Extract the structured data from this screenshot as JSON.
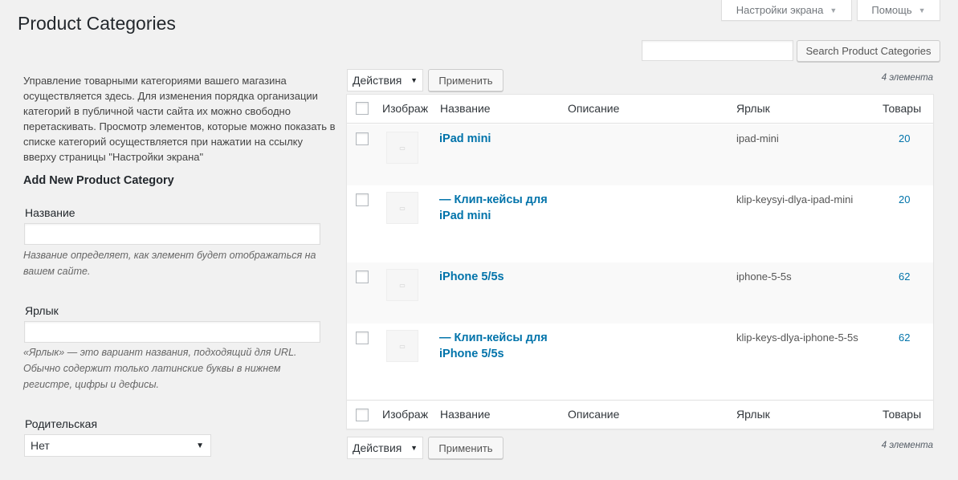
{
  "page_title": "Product Categories",
  "screen_options": {
    "label": "Настройки экрана"
  },
  "help": {
    "label": "Помощь"
  },
  "search": {
    "placeholder": "",
    "button_label": "Search Product Categories"
  },
  "description": "Управление товарными категориями вашего магазина осуществляется здесь. Для изменения порядка организации категорий в публичной части сайта их можно свободно перетаскивать. Просмотр элементов, которые можно показать в списке категорий осуществляется при нажатии на ссылку вверху страницы \"Настройки экрана\"",
  "form": {
    "title": "Add New Product Category",
    "name_label": "Название",
    "name_value": "",
    "name_hint": "Название определяет, как элемент будет отображаться на вашем сайте.",
    "slug_label": "Ярлык",
    "slug_value": "",
    "slug_hint": "«Ярлык» — это вариант названия, подходящий для URL. Обычно содержит только латинские буквы в нижнем регистре, цифры и дефисы.",
    "parent_label": "Родительская",
    "parent_value": "Нет"
  },
  "bulk_actions": {
    "label": "Действия",
    "apply_label": "Применить"
  },
  "item_count": "4 элемента",
  "table": {
    "columns": [
      "Изображ",
      "Название",
      "Описание",
      "Ярлык",
      "Товары"
    ],
    "rows": [
      {
        "name": "iPad mini",
        "description": "",
        "slug": "ipad-mini",
        "count": "20"
      },
      {
        "name": "— Клип-кейсы для iPad mini",
        "description": "",
        "slug": "klip-keysyi-dlya-ipad-mini",
        "count": "20"
      },
      {
        "name": "iPhone 5/5s",
        "description": "",
        "slug": "iphone-5-5s",
        "count": "62"
      },
      {
        "name": "— Клип-кейсы для iPhone 5/5s",
        "description": "",
        "slug": "klip-keys-dlya-iphone-5-5s",
        "count": "62"
      }
    ]
  },
  "colors": {
    "link": "#0073aa",
    "background": "#f1f1f1"
  }
}
